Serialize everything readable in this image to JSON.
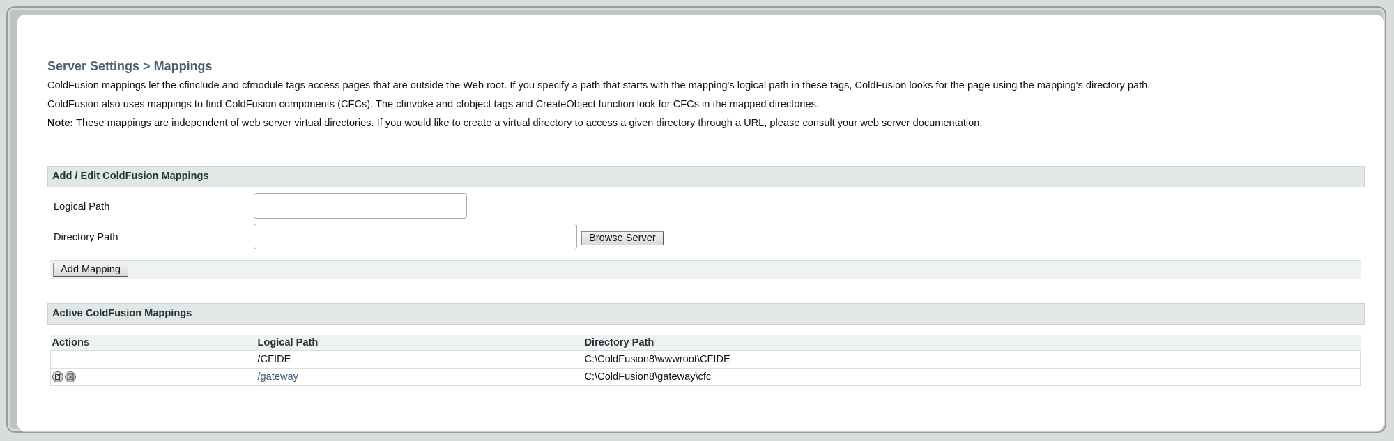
{
  "page": {
    "title": "Server Settings > Mappings",
    "paragraph1": "ColdFusion mappings let the cfinclude and cfmodule tags access pages that are outside the Web root. If you specify a path that starts with the mapping's logical path in these tags, ColdFusion looks for the page using the mapping's directory path.",
    "paragraph2": "ColdFusion also uses mappings to find ColdFusion components (CFCs). The cfinvoke and cfobject tags and CreateObject function look for CFCs in the mapped directories.",
    "note_label": "Note:",
    "note_text": " These mappings are independent of web server virtual directories. If you would like to create a virtual directory to access a given directory through a URL, please consult your web server documentation."
  },
  "add_edit": {
    "heading": "Add / Edit ColdFusion Mappings",
    "logical_path_label": "Logical Path",
    "logical_path_value": "",
    "directory_path_label": "Directory Path",
    "directory_path_value": "",
    "browse_button": "Browse Server",
    "add_button": "Add Mapping"
  },
  "active": {
    "heading": "Active ColdFusion Mappings",
    "columns": [
      "Actions",
      "Logical Path",
      "Directory Path"
    ],
    "rows": [
      {
        "actions": [],
        "logical_path": "/CFIDE",
        "directory_path": "C:\\ColdFusion8\\wwwroot\\CFIDE",
        "link": false
      },
      {
        "actions": [
          "edit-icon",
          "delete-icon"
        ],
        "logical_path": "/gateway",
        "directory_path": "C:\\ColdFusion8\\gateway\\cfc",
        "link": true
      }
    ]
  },
  "colors": {
    "title": "#4c5f73",
    "section_header_bg": "#e1e6e6",
    "link": "#3a5a7a",
    "outer_frame": "#bfc3c3"
  }
}
